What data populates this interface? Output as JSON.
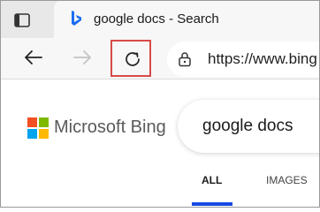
{
  "tab": {
    "title": "google docs - Search"
  },
  "toolbar": {
    "url": "https://www.bing"
  },
  "page": {
    "logo_text": "Microsoft Bing",
    "query": "google docs",
    "scopes": [
      "ALL",
      "IMAGES"
    ],
    "active_scope": "ALL"
  },
  "colors": {
    "highlight_box": "#d84a4a",
    "bing_accent": "#174ae4",
    "logo_red": "#f25022",
    "logo_green": "#7fba00",
    "logo_blue": "#00a4ef",
    "logo_yellow": "#ffb900"
  },
  "icons": {
    "tab_actions": "tab-actions-icon",
    "favicon": "bing-favicon-icon",
    "back": "back-arrow-icon",
    "forward": "forward-arrow-icon",
    "refresh": "refresh-icon",
    "lock": "lock-icon"
  }
}
